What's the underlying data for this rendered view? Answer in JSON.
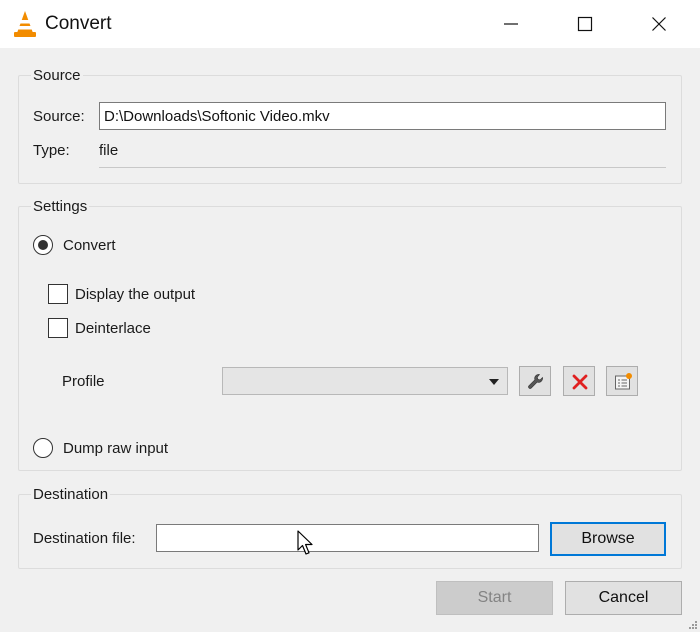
{
  "window": {
    "title": "Convert",
    "app_icon": "vlc-cone-icon",
    "controls": [
      "minimize-icon",
      "maximize-icon",
      "close-icon"
    ]
  },
  "source": {
    "group_title": "Source",
    "source_label": "Source:",
    "source_value": "D:\\Downloads\\Softonic Video.mkv",
    "type_label": "Type:",
    "type_value": "file"
  },
  "settings": {
    "group_title": "Settings",
    "convert_label": "Convert",
    "convert_selected": true,
    "display_output_label": "Display the output",
    "display_output_checked": false,
    "deinterlace_label": "Deinterlace",
    "deinterlace_checked": false,
    "profile_label": "Profile",
    "profile_value": "",
    "profile_tools": [
      "wrench-icon",
      "delete-icon",
      "new-profile-icon"
    ],
    "dump_raw_label": "Dump raw input",
    "dump_raw_selected": false
  },
  "destination": {
    "group_title": "Destination",
    "file_label": "Destination file:",
    "file_value": "",
    "browse_label": "Browse"
  },
  "footer": {
    "start_label": "Start",
    "start_enabled": false,
    "cancel_label": "Cancel"
  },
  "colors": {
    "accent": "#0078d7",
    "vlc_orange": "#f28c00",
    "delete_red": "#e02020"
  }
}
